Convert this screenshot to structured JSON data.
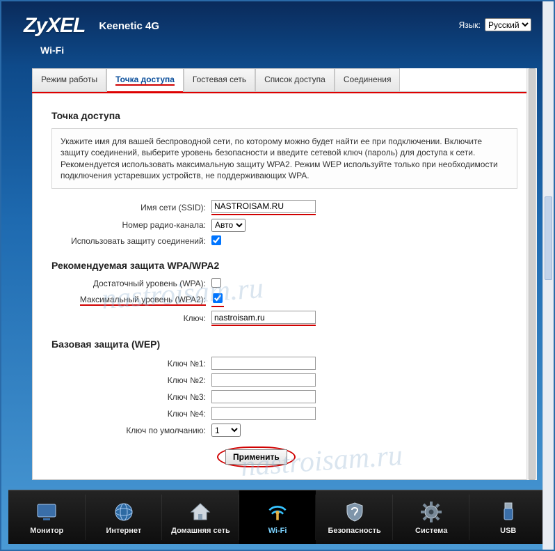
{
  "brand": "ZyXEL",
  "model": "Keenetic 4G",
  "lang_label": "Язык:",
  "lang_value": "Русский",
  "subhead": "Wi-Fi",
  "tabs": [
    {
      "id": "mode",
      "label": "Режим работы"
    },
    {
      "id": "ap",
      "label": "Точка доступа"
    },
    {
      "id": "guest",
      "label": "Гостевая сеть"
    },
    {
      "id": "acl",
      "label": "Список доступа"
    },
    {
      "id": "conn",
      "label": "Соединения"
    }
  ],
  "active_tab": "ap",
  "section": {
    "title": "Точка доступа",
    "desc": "Укажите имя для вашей беспроводной сети, по которому можно будет найти ее при подключении. Включите защиту соединений, выберите уровень безопасности и введите сетевой ключ (пароль) для доступа к сети. Рекомендуется использовать максимальную защиту WPA2. Режим WEP используйте только при необходимости подключения устаревших устройств, не поддерживающих WPA."
  },
  "fields": {
    "ssid_label": "Имя сети (SSID):",
    "ssid_value": "NASTROISAM.RU",
    "channel_label": "Номер радио-канала:",
    "channel_value": "Авто",
    "protect_label": "Использовать защиту соединений:",
    "protect_checked": true
  },
  "wpa_title": "Рекомендуемая защита WPA/WPA2",
  "wpa": {
    "suff_label": "Достаточный уровень (WPA):",
    "suff_checked": false,
    "max_label": "Максимальный уровень (WPA2):",
    "max_checked": true,
    "key_label": "Ключ:",
    "key_value": "nastroisam.ru"
  },
  "wep_title": "Базовая защита (WEP)",
  "wep": {
    "k1_label": "Ключ №1:",
    "k1_value": "",
    "k2_label": "Ключ №2:",
    "k2_value": "",
    "k3_label": "Ключ №3:",
    "k3_value": "",
    "k4_label": "Ключ №4:",
    "k4_value": "",
    "def_label": "Ключ по умолчанию:",
    "def_value": "1"
  },
  "apply_label": "Применить",
  "bottom_nav": [
    {
      "id": "monitor",
      "label": "Монитор"
    },
    {
      "id": "internet",
      "label": "Интернет"
    },
    {
      "id": "home",
      "label": "Домашняя сеть"
    },
    {
      "id": "wifi",
      "label": "Wi-Fi"
    },
    {
      "id": "security",
      "label": "Безопасность"
    },
    {
      "id": "system",
      "label": "Система"
    },
    {
      "id": "usb",
      "label": "USB"
    }
  ],
  "active_nav": "wifi",
  "watermark": "nastroisam.ru",
  "colors": {
    "accent": "#d00000",
    "link": "#0a4e9b"
  }
}
